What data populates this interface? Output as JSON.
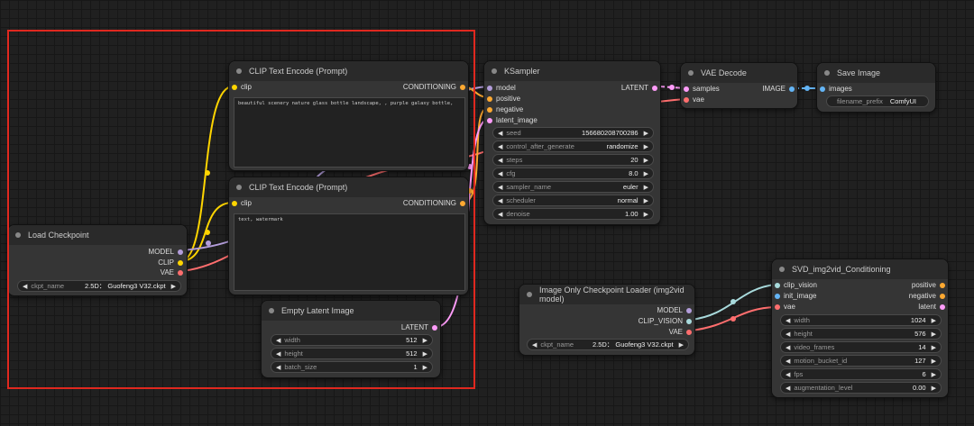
{
  "nodes": {
    "clip_pos": {
      "title": "CLIP Text Encode (Prompt)",
      "in_clip": "clip",
      "out_cond": "CONDITIONING",
      "text": "beautiful scenery nature glass bottle landscape, , purple galaxy bottle,"
    },
    "clip_neg": {
      "title": "CLIP Text Encode (Prompt)",
      "in_clip": "clip",
      "out_cond": "CONDITIONING",
      "text": "text, watermark"
    },
    "ksampler": {
      "title": "KSampler",
      "in_model": "model",
      "in_positive": "positive",
      "in_negative": "negative",
      "in_latent": "latent_image",
      "out_latent": "LATENT",
      "widgets": [
        {
          "name": "seed",
          "value": "156680208700286"
        },
        {
          "name": "control_after_generate",
          "value": "randomize"
        },
        {
          "name": "steps",
          "value": "20"
        },
        {
          "name": "cfg",
          "value": "8.0"
        },
        {
          "name": "sampler_name",
          "value": "euler"
        },
        {
          "name": "scheduler",
          "value": "normal"
        },
        {
          "name": "denoise",
          "value": "1.00"
        }
      ]
    },
    "vae_decode": {
      "title": "VAE Decode",
      "in_samples": "samples",
      "in_vae": "vae",
      "out_image": "IMAGE"
    },
    "save_image": {
      "title": "Save Image",
      "in_images": "images",
      "widget": {
        "name": "filename_prefix",
        "value": "ComfyUI"
      }
    },
    "load_ckpt": {
      "title": "Load Checkpoint",
      "out_model": "MODEL",
      "out_clip": "CLIP",
      "out_vae": "VAE",
      "widget": {
        "name": "ckpt_name",
        "value": "2.5D： Guofeng3 V32.ckpt"
      }
    },
    "empty_latent": {
      "title": "Empty Latent Image",
      "out_latent": "LATENT",
      "widgets": [
        {
          "name": "width",
          "value": "512"
        },
        {
          "name": "height",
          "value": "512"
        },
        {
          "name": "batch_size",
          "value": "1"
        }
      ]
    },
    "img2vid_loader": {
      "title": "Image Only Checkpoint Loader (img2vid model)",
      "out_model": "MODEL",
      "out_vision": "CLIP_VISION",
      "out_vae": "VAE",
      "widget": {
        "name": "ckpt_name",
        "value": "2.5D： Guofeng3 V32.ckpt"
      }
    },
    "svd_cond": {
      "title": "SVD_img2vid_Conditioning",
      "in_vision": "clip_vision",
      "in_image": "init_image",
      "in_vae": "vae",
      "out_positive": "positive",
      "out_negative": "negative",
      "out_latent": "latent",
      "widgets": [
        {
          "name": "width",
          "value": "1024"
        },
        {
          "name": "height",
          "value": "576"
        },
        {
          "name": "video_frames",
          "value": "14"
        },
        {
          "name": "motion_bucket_id",
          "value": "127"
        },
        {
          "name": "fps",
          "value": "6"
        },
        {
          "name": "augmentation_level",
          "value": "0.00"
        }
      ]
    }
  },
  "colors": {
    "model": "#b39ddb",
    "clip": "#ffd500",
    "vae": "#ff6e6e",
    "conditioning": "#ffa931",
    "latent": "#ff9cf9",
    "image": "#64b5f6",
    "clip_vision": "#a8dadc",
    "selection": "#e0281f"
  }
}
